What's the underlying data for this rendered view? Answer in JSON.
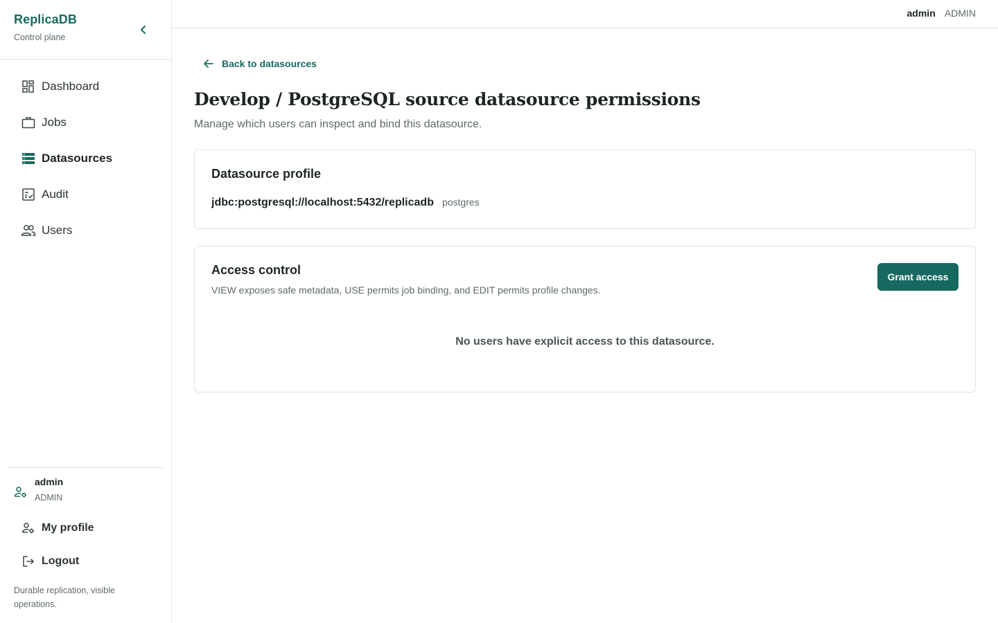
{
  "brand": {
    "name": "ReplicaDB",
    "subtitle": "Control plane"
  },
  "sidebar": {
    "items": [
      {
        "label": "Dashboard",
        "icon": "dashboard-icon",
        "active": false
      },
      {
        "label": "Jobs",
        "icon": "briefcase-icon",
        "active": false
      },
      {
        "label": "Datasources",
        "icon": "database-list-icon",
        "active": true
      },
      {
        "label": "Audit",
        "icon": "audit-checklist-icon",
        "active": false
      },
      {
        "label": "Users",
        "icon": "users-icon",
        "active": false
      }
    ],
    "user": {
      "name": "admin",
      "role": "ADMIN"
    },
    "bottom_items": [
      {
        "label": "My profile",
        "icon": "user-settings-icon"
      },
      {
        "label": "Logout",
        "icon": "logout-icon"
      }
    ],
    "tagline": "Durable replication, visible operations."
  },
  "topbar": {
    "user_name": "admin",
    "user_role": "ADMIN"
  },
  "main": {
    "back_label": "Back to datasources",
    "title": "Develop / PostgreSQL source datasource permissions",
    "subtitle": "Manage which users can inspect and bind this datasource.",
    "profile_card": {
      "title": "Datasource profile",
      "url": "jdbc:postgresql://localhost:5432/replicadb",
      "username": "postgres"
    },
    "access_card": {
      "title": "Access control",
      "description": "VIEW exposes safe metadata, USE permits job binding, and EDIT permits profile changes.",
      "grant_label": "Grant access",
      "empty_message": "No users have explicit access to this datasource."
    }
  },
  "colors": {
    "accent": "#17695f",
    "border": "#dfe3e2",
    "muted_text": "#5f6a68"
  }
}
